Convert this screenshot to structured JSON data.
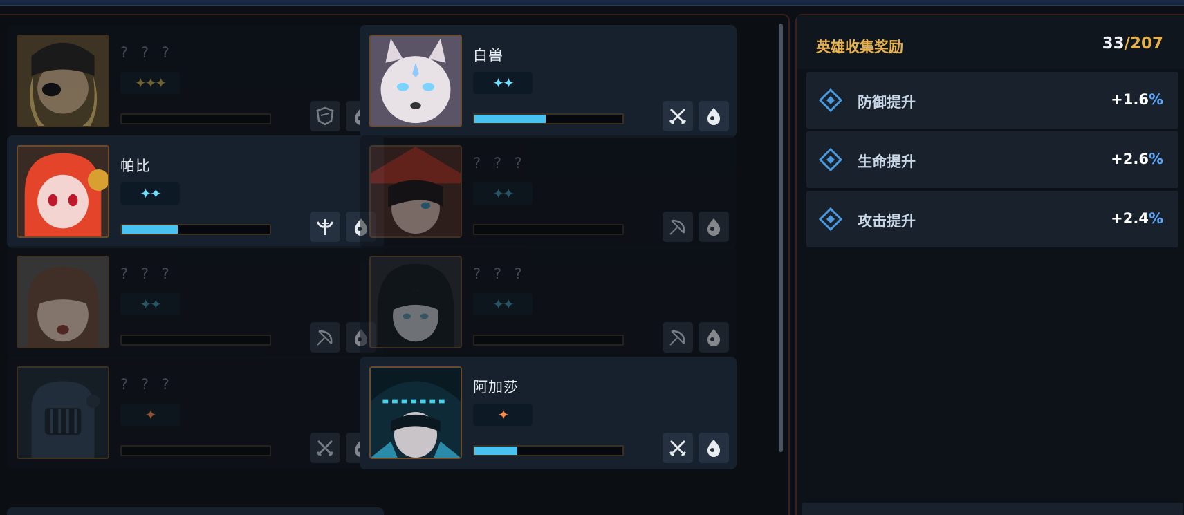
{
  "colors": {
    "accent_gold": "#e6b14a",
    "progress_fill": "#48c2f0",
    "percent_blue": "#5aa8ff",
    "star_blue": "#6fe0ff",
    "star_gold": "#c8a84a",
    "star_orange": "#ff8a4a"
  },
  "heroes": [
    {
      "name": "? ? ?",
      "owned": false,
      "stars": "✦✦✦",
      "star_color": "gold",
      "progress": 0,
      "role_icon": "shield-icon",
      "element_icon": "water-drop-icon"
    },
    {
      "name": "白兽",
      "owned": true,
      "stars": "✦✦",
      "star_color": "blue",
      "progress": 0.48,
      "role_icon": "crossed-swords-icon",
      "element_icon": "water-drop-icon"
    },
    {
      "name": "帕比",
      "owned": true,
      "stars": "✦✦",
      "star_color": "blue",
      "progress": 0.38,
      "role_icon": "support-staff-icon",
      "element_icon": "water-drop-icon"
    },
    {
      "name": "? ? ?",
      "owned": false,
      "stars": "✦✦",
      "star_color": "blue",
      "progress": 0,
      "role_icon": "bow-icon",
      "element_icon": "water-drop-icon"
    },
    {
      "name": "? ? ?",
      "owned": false,
      "stars": "✦✦",
      "star_color": "blue",
      "progress": 0,
      "role_icon": "bow-icon",
      "element_icon": "water-drop-icon"
    },
    {
      "name": "? ? ?",
      "owned": false,
      "stars": "✦✦",
      "star_color": "blue",
      "progress": 0,
      "role_icon": "bow-icon",
      "element_icon": "water-drop-icon"
    },
    {
      "name": "? ? ?",
      "owned": false,
      "stars": "✦",
      "star_color": "orange",
      "progress": 0,
      "role_icon": "crossed-swords-icon",
      "element_icon": "water-drop-icon"
    },
    {
      "name": "阿加莎",
      "owned": true,
      "stars": "✦",
      "star_color": "orange",
      "progress": 0.29,
      "role_icon": "crossed-swords-icon",
      "element_icon": "water-drop-icon"
    }
  ],
  "reward": {
    "title": "英雄收集奖励",
    "current": "33",
    "separator": "/",
    "total": "207",
    "bonuses": [
      {
        "label": "防御提升",
        "value": "+1.6",
        "unit": "%"
      },
      {
        "label": "生命提升",
        "value": "+2.6",
        "unit": "%"
      },
      {
        "label": "攻击提升",
        "value": "+2.4",
        "unit": "%"
      }
    ]
  }
}
